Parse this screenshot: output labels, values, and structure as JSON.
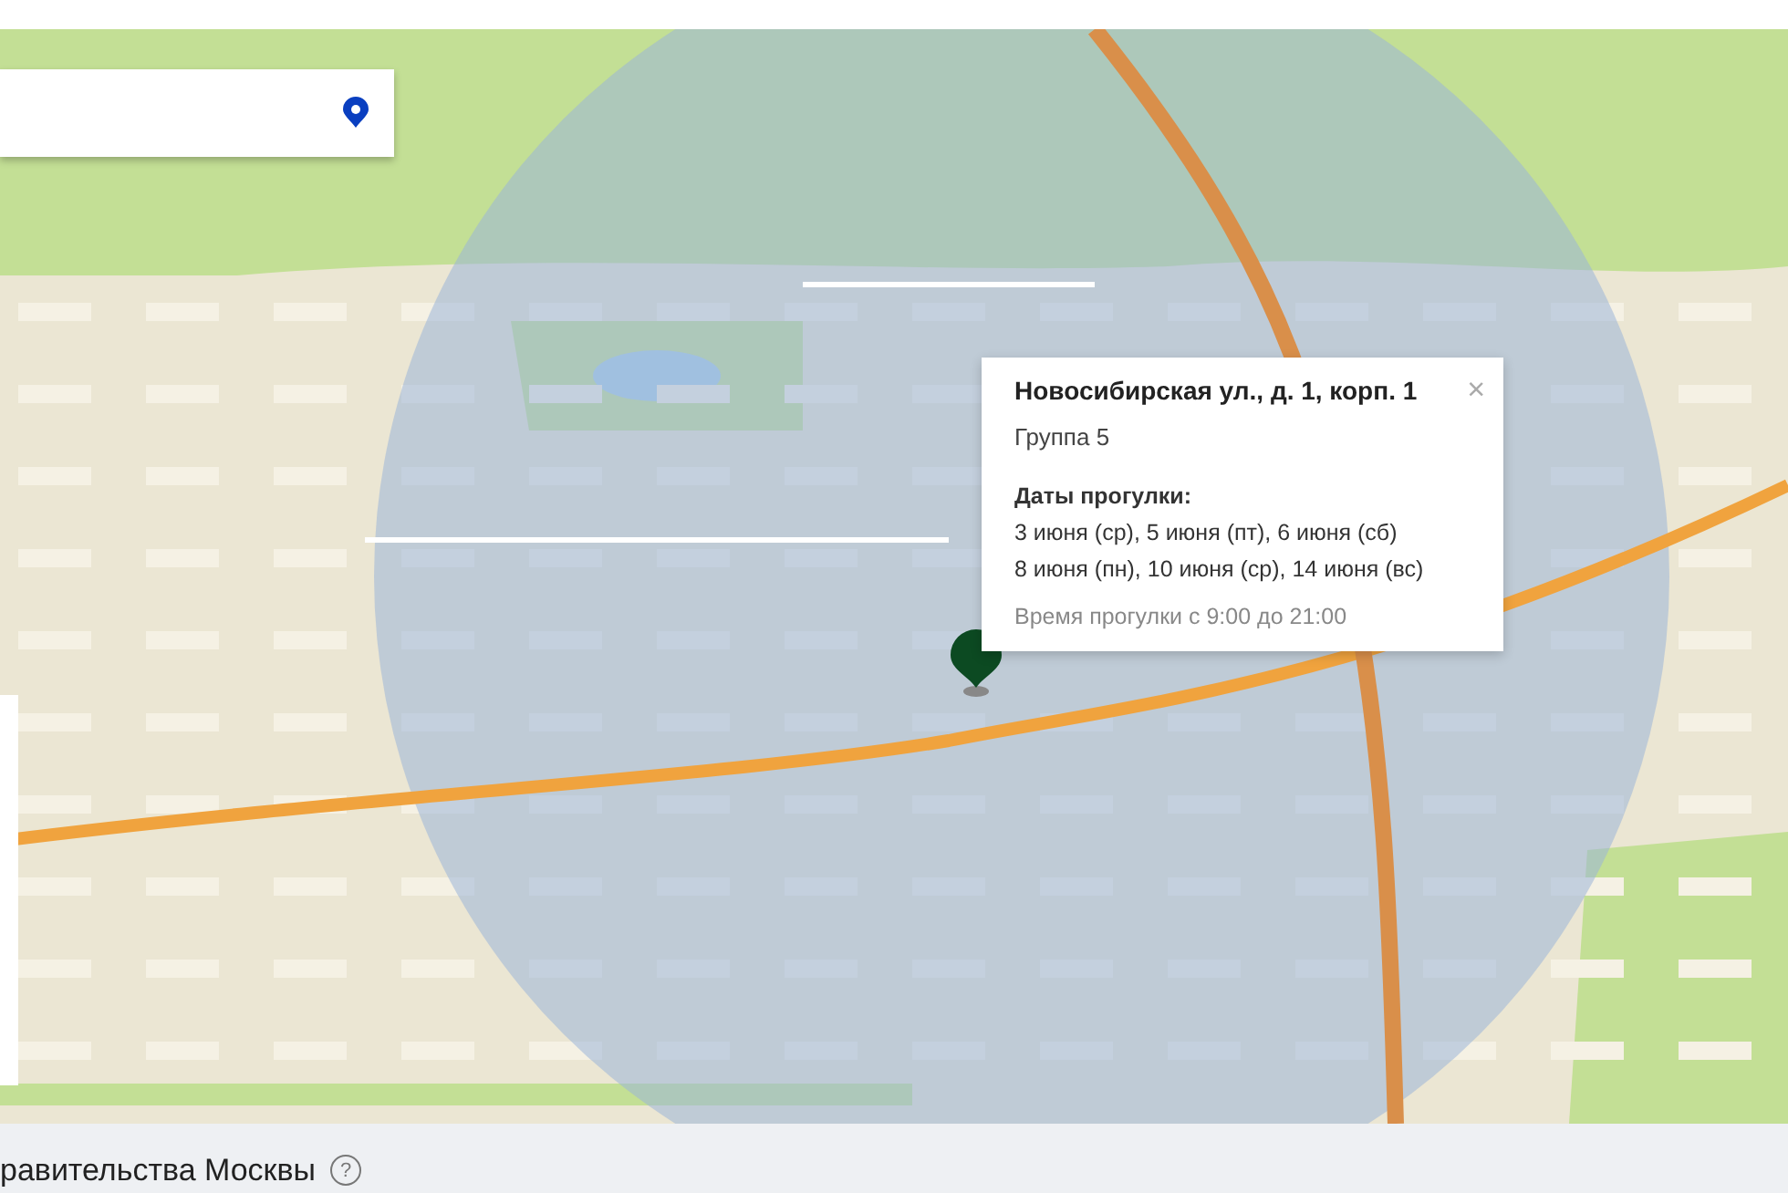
{
  "popup": {
    "title": "Новосибирская ул., д. 1, корп. 1",
    "close": "×",
    "group": "Группа 5",
    "dates_heading": "Даты прогулки:",
    "dates": [
      "3 июня (ср), 5 июня (пт), 6 июня (сб)",
      "8 июня (пн), 10 июня (ср), 14 июня (вс)"
    ],
    "time": "Время прогулки с 9:00 до 21:00"
  },
  "footer": {
    "title": "равительства Москвы",
    "help": "?"
  }
}
